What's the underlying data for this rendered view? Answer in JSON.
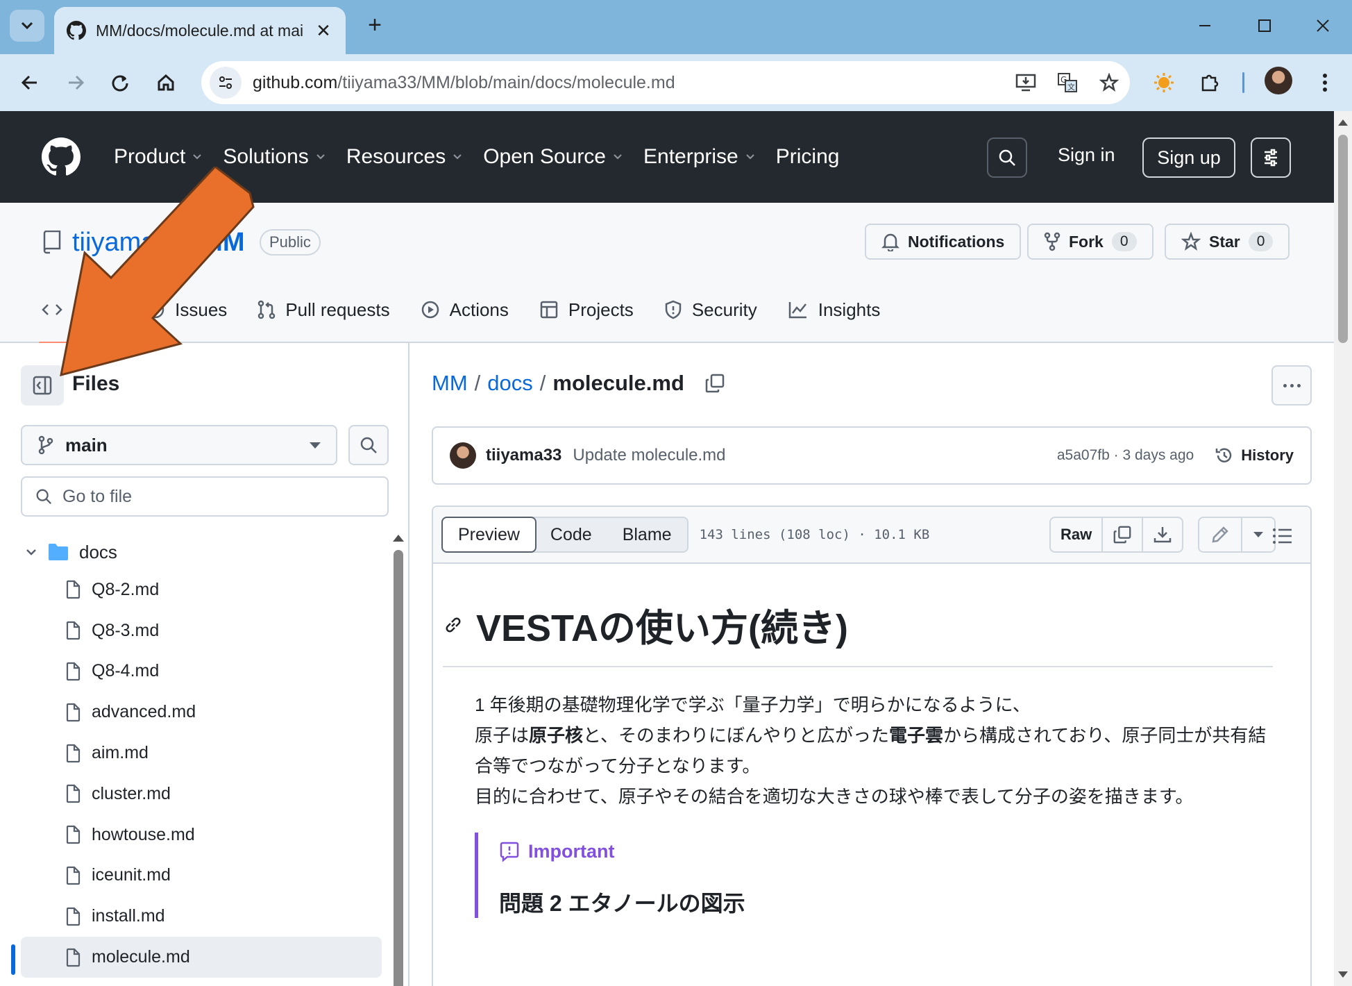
{
  "browser": {
    "tab_title": "MM/docs/molecule.md at main",
    "url_host": "github.com",
    "url_path": "/tiiyama33/MM/blob/main/docs/molecule.md"
  },
  "header": {
    "nav": [
      "Product",
      "Solutions",
      "Resources",
      "Open Source",
      "Enterprise",
      "Pricing"
    ],
    "sign_in": "Sign in",
    "sign_up": "Sign up"
  },
  "repo": {
    "owner": "tiiyama33",
    "name": "MM",
    "visibility": "Public",
    "notifications_label": "Notifications",
    "fork_label": "Fork",
    "fork_count": "0",
    "star_label": "Star",
    "star_count": "0",
    "tabs": [
      "Code",
      "Issues",
      "Pull requests",
      "Actions",
      "Projects",
      "Security",
      "Insights"
    ]
  },
  "sidebar": {
    "title": "Files",
    "branch": "main",
    "search_placeholder": "Go to file",
    "folder": "docs",
    "files": [
      "Q8-2.md",
      "Q8-3.md",
      "Q8-4.md",
      "advanced.md",
      "aim.md",
      "cluster.md",
      "howtouse.md",
      "iceunit.md",
      "install.md",
      "molecule.md"
    ],
    "selected_file": "molecule.md"
  },
  "file": {
    "breadcrumb_repo": "MM",
    "breadcrumb_dir": "docs",
    "breadcrumb_file": "molecule.md",
    "commit_author": "tiiyama33",
    "commit_message": "Update molecule.md",
    "commit_meta": "a5a07fb · 3 days ago",
    "history_label": "History",
    "view_tabs": [
      "Preview",
      "Code",
      "Blame"
    ],
    "info": "143 lines (108 loc) · 10.1 KB",
    "raw_label": "Raw"
  },
  "markdown": {
    "h1": "VESTAの使い方(続き)",
    "p1_line1": "1 年後期の基礎物理化学で学ぶ「量子力学」で明らかになるように、",
    "p1_a": "原子は",
    "p1_b": "原子核",
    "p1_c": "と、そのまわりにぼんやりと広がった",
    "p1_d": "電子雲",
    "p1_e": "から構成されており、原子同士が共有結合等でつながって分子となります。",
    "p1_line3": "目的に合わせて、原子やその結合を適切な大きさの球や棒で表して分子の姿を描きます。",
    "alert_title": "Important",
    "alert_heading": "問題 2 エタノールの図示"
  },
  "colors": {
    "annotation_arrow": "#e8702a",
    "accent": "#0969da",
    "alert": "#8250df"
  }
}
